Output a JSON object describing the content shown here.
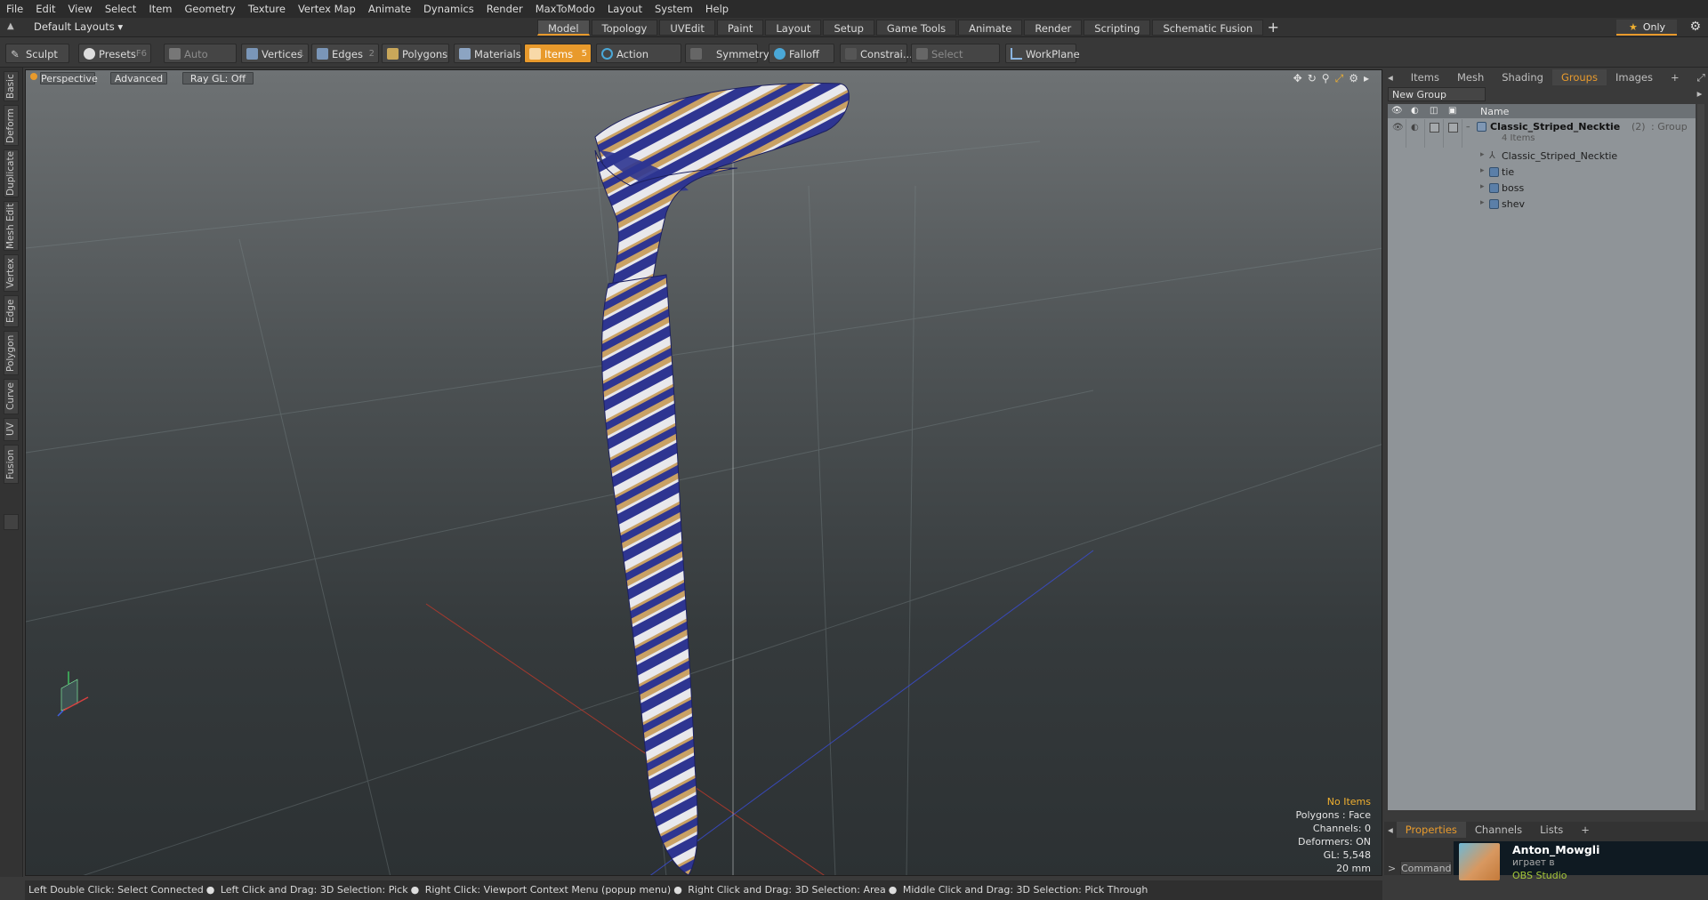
{
  "menu": [
    "File",
    "Edit",
    "View",
    "Select",
    "Item",
    "Geometry",
    "Texture",
    "Vertex Map",
    "Animate",
    "Dynamics",
    "Render",
    "MaxToModo",
    "Layout",
    "System",
    "Help"
  ],
  "layoutbar": {
    "layouts_label": "Default Layouts ▾",
    "tabs": [
      "Model",
      "Topology",
      "UVEdit",
      "Paint",
      "Layout",
      "Setup",
      "Game Tools",
      "Animate",
      "Render",
      "Scripting",
      "Schematic Fusion"
    ],
    "active_tab": "Model",
    "only_label": "Only"
  },
  "toolbar": {
    "sculpt": "Sculpt",
    "presets": "Presets",
    "presets_key": "F6",
    "auto_select": "Auto Select",
    "vertices": "Vertices",
    "vertices_num": "1",
    "edges": "Edges",
    "edges_num": "2",
    "polygons": "Polygons",
    "materials": "Materials",
    "items": "Items",
    "items_num": "5",
    "action_center": "Action Center",
    "symmetry": "Symmetry",
    "falloff": "Falloff",
    "constraints": "Constrai...",
    "select_through": "Select Through",
    "workplane": "WorkPlane"
  },
  "left_tabs": [
    "Basic",
    "Deform",
    "Duplicate",
    "Mesh Edit",
    "Vertex",
    "Edge",
    "Polygon",
    "Curve",
    "UV",
    "Fusion"
  ],
  "viewport": {
    "view_label": "Perspective",
    "advanced_label": "Advanced",
    "raygl_label": "Ray GL: Off",
    "hud": {
      "no_items": "No Items",
      "polygons": "Polygons : Face",
      "channels": "Channels: 0",
      "deformers": "Deformers: ON",
      "gl": "GL: 5,548",
      "scale": "20 mm"
    }
  },
  "right_panel": {
    "tabs": [
      "Items",
      "Mesh Ops",
      "Shading",
      "Groups",
      "Images"
    ],
    "active_tab": "Groups",
    "new_group": "New Group",
    "name_header": "Name",
    "group": {
      "name": "Classic_Striped_Necktie",
      "count": "(2)",
      "type": ": Group",
      "sub": "4 Items"
    },
    "items": [
      "Classic_Striped_Necktie",
      "tie",
      "boss",
      "shev"
    ]
  },
  "properties": {
    "tabs": [
      "Properties",
      "Channels",
      "Lists"
    ],
    "active_tab": "Properties",
    "command": "Command"
  },
  "obs": {
    "name": "Anton_Mowgli",
    "playing": "играет в",
    "game": "OBS Studio"
  },
  "statusbar": [
    "Left Double Click: Select Connected",
    "Left Click and Drag: 3D Selection: Pick",
    "Right Click: Viewport Context Menu (popup menu)",
    "Right Click and Drag: 3D Selection: Area",
    "Middle Click and Drag: 3D Selection: Pick Through"
  ],
  "colors": {
    "accent": "#e89a2c",
    "stripe_navy": "#2e3591",
    "stripe_gold": "#c9a164",
    "stripe_white": "#e8e8ec"
  }
}
